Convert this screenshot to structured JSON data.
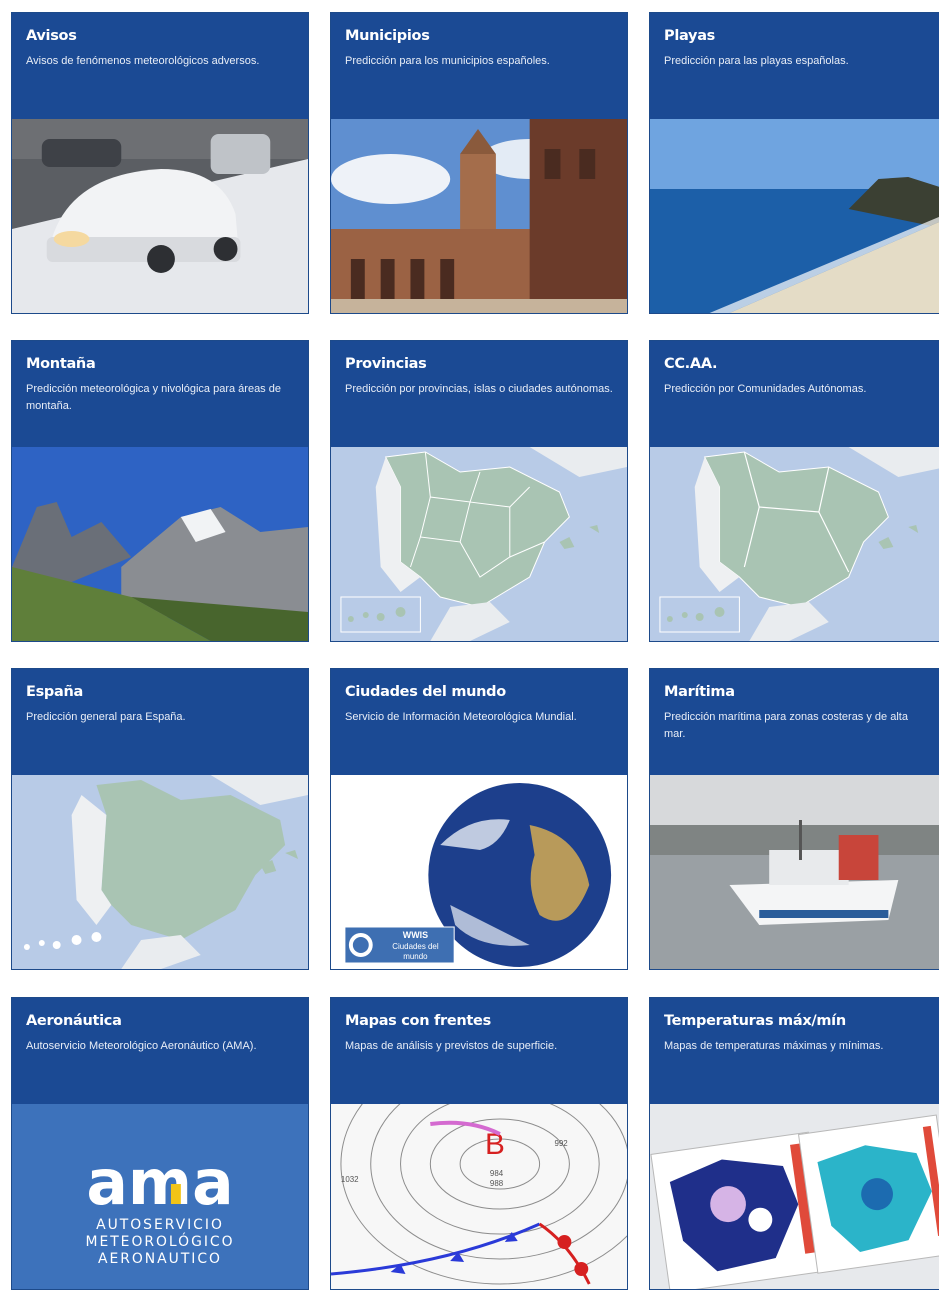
{
  "colors": {
    "header_bg": "#1b4a94",
    "header_text": "#ffffff",
    "map_land": "#a9c4b3",
    "map_sea": "#b8cbe7"
  },
  "cards": [
    {
      "title": "Avisos",
      "description": "Avisos de fenómenos meteorológicos adversos.",
      "image": "snow-covered-car-photo"
    },
    {
      "title": "Municipios",
      "description": "Predicción para los municipios españoles.",
      "image": "town-square-photo"
    },
    {
      "title": "Playas",
      "description": "Predicción para las playas españolas.",
      "image": "beach-photo"
    },
    {
      "title": "Montaña",
      "description": "Predicción meteorológica y nivológica para áreas de montaña.",
      "image": "mountain-photo"
    },
    {
      "title": "Provincias",
      "description": "Predicción por provincias, islas o ciudades autónomas.",
      "image": "provinces-map"
    },
    {
      "title": "CC.AA.",
      "description": "Predicción por Comunidades Autónomas.",
      "image": "regions-map"
    },
    {
      "title": "España",
      "description": "Predicción general para España.",
      "image": "spain-map"
    },
    {
      "title": "Ciudades del mundo",
      "description": "Servicio de Información Meteorológica Mundial.",
      "image": "earth-globe"
    },
    {
      "title": "Marítima",
      "description": "Predicción marítima para zonas costeras y de alta mar.",
      "image": "fishing-boat-photo"
    },
    {
      "title": "Aeronáutica",
      "description": "Autoservicio Meteorológico Aeronáutico (AMA).",
      "image": "ama-logo"
    },
    {
      "title": "Mapas con frentes",
      "description": "Mapas de análisis y previstos de superficie.",
      "image": "weather-fronts-map"
    },
    {
      "title": "Temperaturas máx/mín",
      "description": "Mapas de temperaturas máximas y mínimas.",
      "image": "temperature-maps"
    }
  ],
  "wmo_badge": {
    "line1": "WWIS",
    "line2": "Ciudades del",
    "line3": "mundo"
  },
  "ama_logo": {
    "wordmark": "ama",
    "line1": "AUTOSERVICIO",
    "line2": "METEOROLÓGICO",
    "line3": "AERONAUTICO"
  },
  "fronts_map": {
    "low_label": "B",
    "pressure_labels": [
      "984",
      "988",
      "1032",
      "992"
    ]
  }
}
